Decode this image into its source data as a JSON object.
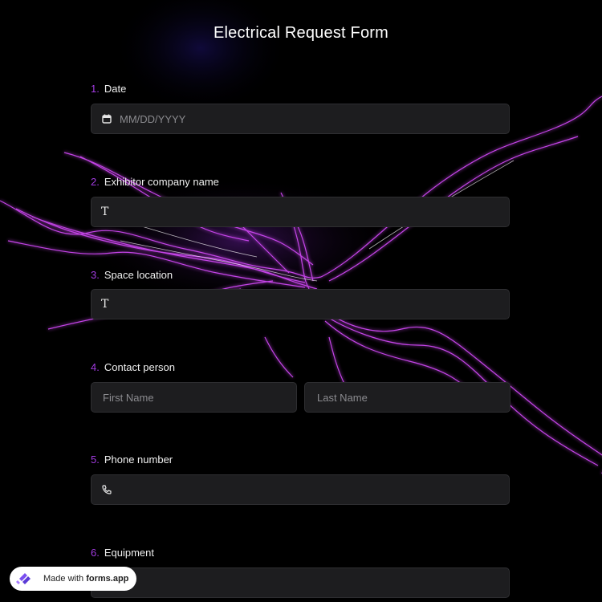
{
  "form": {
    "title": "Electrical Request Form"
  },
  "questions": [
    {
      "number": "1.",
      "label": "Date",
      "placeholder": "MM/DD/YYYY",
      "icon": "calendar-icon"
    },
    {
      "number": "2.",
      "label": "Exhibitor company name",
      "icon": "text-icon",
      "icon_glyph": "T"
    },
    {
      "number": "3.",
      "label": "Space location",
      "icon": "text-icon",
      "icon_glyph": "T"
    },
    {
      "number": "4.",
      "label": "Contact person",
      "first_placeholder": "First Name",
      "last_placeholder": "Last Name"
    },
    {
      "number": "5.",
      "label": "Phone number",
      "icon": "phone-icon"
    },
    {
      "number": "6.",
      "label": "Equipment"
    }
  ],
  "badge": {
    "prefix": "Made with",
    "brand": "forms.app"
  },
  "colors": {
    "accent": "#a23be0",
    "field_bg": "#1d1d1f",
    "background": "#000000",
    "lightning": "#d94cff"
  }
}
